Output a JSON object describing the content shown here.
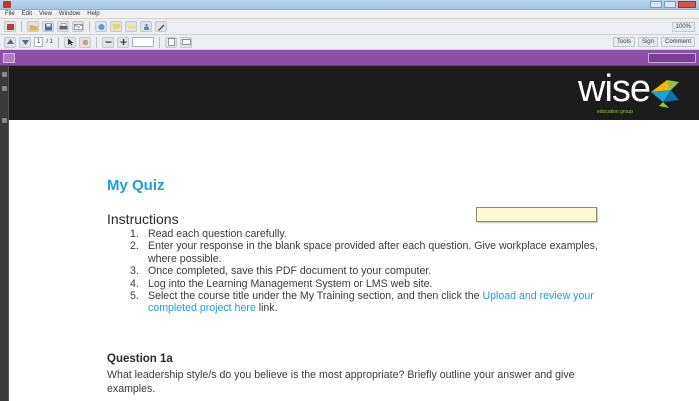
{
  "window": {
    "title": "",
    "menu": [
      "File",
      "Edit",
      "View",
      "Window",
      "Help"
    ]
  },
  "toolbar": {
    "page_number": "1",
    "page_total": "/ 1",
    "zoom": "100%",
    "right_buttons": [
      "Tools",
      "Sign",
      "Comment"
    ]
  },
  "document_bar": {
    "tab_label": ""
  },
  "brand": {
    "logo_text": "wise",
    "logo_subtitle": "education group",
    "colors": {
      "banner": "#1c1c1c",
      "accent_blue": "#1d9fd8",
      "accent_green": "#8cc63f",
      "doc_bar": "#8e4fa8"
    }
  },
  "content": {
    "quiz_title": "My Quiz",
    "instructions_heading": "Instructions",
    "instructions": [
      {
        "num": "1.",
        "text": "Read each question carefully."
      },
      {
        "num": "2.",
        "text": "Enter your response in the blank space provided after each question. Give workplace examples, where possible."
      },
      {
        "num": "3.",
        "text": "Once completed, save this PDF document to your computer."
      },
      {
        "num": "4.",
        "text": "Log into the Learning Management System or LMS web site."
      },
      {
        "num": "5.",
        "text_before": "Select the course title under the My Training section, and then click the ",
        "link": "Upload and review your completed project here",
        "text_after": " link."
      }
    ],
    "question_heading": "Question 1a",
    "question_text": "What leadership style/s do you believe is the most appropriate?  Briefly outline your answer and give examples."
  },
  "tooltip": {
    "lines": [
      "",
      ""
    ]
  }
}
